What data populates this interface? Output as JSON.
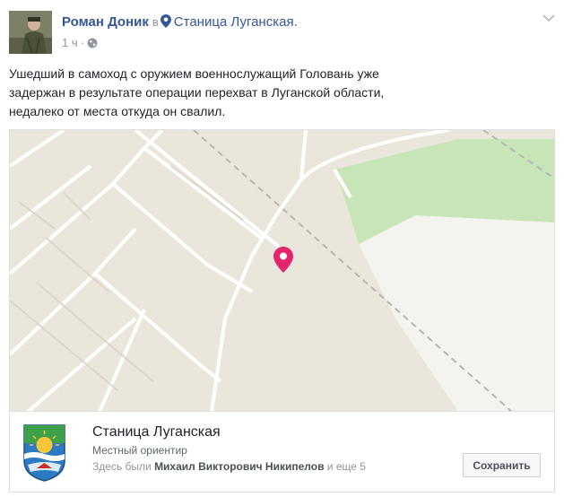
{
  "post": {
    "author": "Роман Доник",
    "in_word": "в",
    "place": "Станица Луганская.",
    "time": "1 ч",
    "dot": "·",
    "text_lines": [
      "Ушедший в самоход с оружием военнослужащий Головань уже",
      "задержан в результате операции перехват в Луганской области,",
      "недалеко от места откуда он свалил."
    ]
  },
  "place_card": {
    "title": "Станица Луганская",
    "subtitle": "Местный ориентир",
    "visited_prefix": "Здесь были",
    "visited_name": "Михаил Викторович Никипелов",
    "visited_suffix": "и еще 5",
    "save_label": "Сохранить"
  },
  "colors": {
    "link": "#365899",
    "map_base": "#ebe6dc",
    "map_green": "#c8e5b8",
    "map_pin": "#e4246e",
    "muted": "#90949c"
  },
  "icons": [
    "map-pin-icon",
    "globe-icon",
    "chevron-down-icon",
    "location-pin-icon",
    "crest-icon"
  ]
}
